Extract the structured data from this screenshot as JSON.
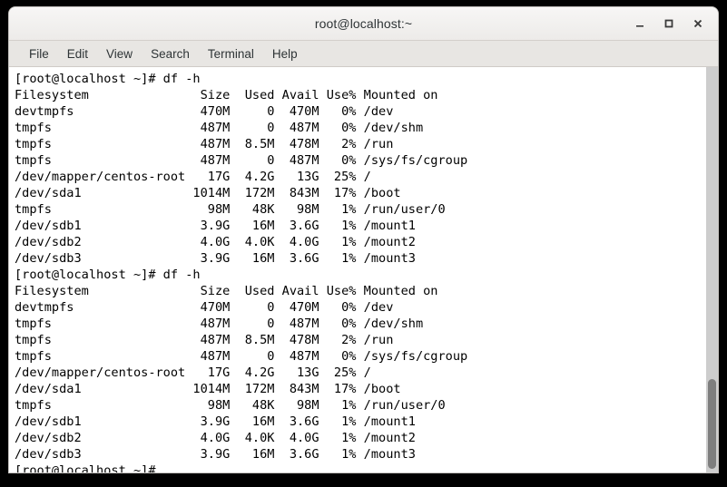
{
  "window": {
    "title": "root@localhost:~",
    "controls": [
      {
        "name": "minimize",
        "label": "–"
      },
      {
        "name": "maximize",
        "label": "□"
      },
      {
        "name": "close",
        "label": "✕"
      }
    ]
  },
  "menubar": {
    "items": [
      {
        "label": "File"
      },
      {
        "label": "Edit"
      },
      {
        "label": "View"
      },
      {
        "label": "Search"
      },
      {
        "label": "Terminal"
      },
      {
        "label": "Help"
      }
    ]
  },
  "terminal": {
    "prompt": "[root@localhost ~]#",
    "command": "df -h",
    "columns": [
      "Filesystem",
      "Size",
      "Used",
      "Avail",
      "Use%",
      "Mounted on"
    ],
    "rows": [
      {
        "filesystem": "devtmpfs",
        "size": "470M",
        "used": "0",
        "avail": "470M",
        "use": "0%",
        "mounted_on": "/dev"
      },
      {
        "filesystem": "tmpfs",
        "size": "487M",
        "used": "0",
        "avail": "487M",
        "use": "0%",
        "mounted_on": "/dev/shm"
      },
      {
        "filesystem": "tmpfs",
        "size": "487M",
        "used": "8.5M",
        "avail": "478M",
        "use": "2%",
        "mounted_on": "/run"
      },
      {
        "filesystem": "tmpfs",
        "size": "487M",
        "used": "0",
        "avail": "487M",
        "use": "0%",
        "mounted_on": "/sys/fs/cgroup"
      },
      {
        "filesystem": "/dev/mapper/centos-root",
        "size": "17G",
        "used": "4.2G",
        "avail": "13G",
        "use": "25%",
        "mounted_on": "/"
      },
      {
        "filesystem": "/dev/sda1",
        "size": "1014M",
        "used": "172M",
        "avail": "843M",
        "use": "17%",
        "mounted_on": "/boot"
      },
      {
        "filesystem": "tmpfs",
        "size": "98M",
        "used": "48K",
        "avail": "98M",
        "use": "1%",
        "mounted_on": "/run/user/0"
      },
      {
        "filesystem": "/dev/sdb1",
        "size": "3.9G",
        "used": "16M",
        "avail": "3.6G",
        "use": "1%",
        "mounted_on": "/mount1"
      },
      {
        "filesystem": "/dev/sdb2",
        "size": "4.0G",
        "used": "4.0K",
        "avail": "4.0G",
        "use": "1%",
        "mounted_on": "/mount2"
      },
      {
        "filesystem": "/dev/sdb3",
        "size": "3.9G",
        "used": "16M",
        "avail": "3.6G",
        "use": "1%",
        "mounted_on": "/mount3"
      }
    ],
    "lines": [
      "[root@localhost ~]# df -h",
      "Filesystem               Size  Used Avail Use% Mounted on",
      "devtmpfs                 470M     0  470M   0% /dev",
      "tmpfs                    487M     0  487M   0% /dev/shm",
      "tmpfs                    487M  8.5M  478M   2% /run",
      "tmpfs                    487M     0  487M   0% /sys/fs/cgroup",
      "/dev/mapper/centos-root   17G  4.2G   13G  25% /",
      "/dev/sda1               1014M  172M  843M  17% /boot",
      "tmpfs                     98M   48K   98M   1% /run/user/0",
      "/dev/sdb1                3.9G   16M  3.6G   1% /mount1",
      "/dev/sdb2                4.0G  4.0K  4.0G   1% /mount2",
      "/dev/sdb3                3.9G   16M  3.6G   1% /mount3",
      "[root@localhost ~]# df -h",
      "Filesystem               Size  Used Avail Use% Mounted on",
      "devtmpfs                 470M     0  470M   0% /dev",
      "tmpfs                    487M     0  487M   0% /dev/shm",
      "tmpfs                    487M  8.5M  478M   2% /run",
      "tmpfs                    487M     0  487M   0% /sys/fs/cgroup",
      "/dev/mapper/centos-root   17G  4.2G   13G  25% /",
      "/dev/sda1               1014M  172M  843M  17% /boot",
      "tmpfs                     98M   48K   98M   1% /run/user/0",
      "/dev/sdb1                3.9G   16M  3.6G   1% /mount1",
      "/dev/sdb2                4.0G  4.0K  4.0G   1% /mount2",
      "/dev/sdb3                3.9G   16M  3.6G   1% /mount3",
      "[root@localhost ~]#"
    ]
  },
  "scrollbar": {
    "thumb_top_pct": 77,
    "thumb_height_pct": 22
  },
  "colors": {
    "terminal_bg": "#ffffff",
    "terminal_fg": "#000000",
    "titlebar_bg": "#f2f1f0",
    "menubar_bg": "#e8e6e3",
    "scrollbar_track": "#cdcdcd",
    "scrollbar_thumb": "#7e7e7e",
    "desktop_bg": "#000000"
  }
}
